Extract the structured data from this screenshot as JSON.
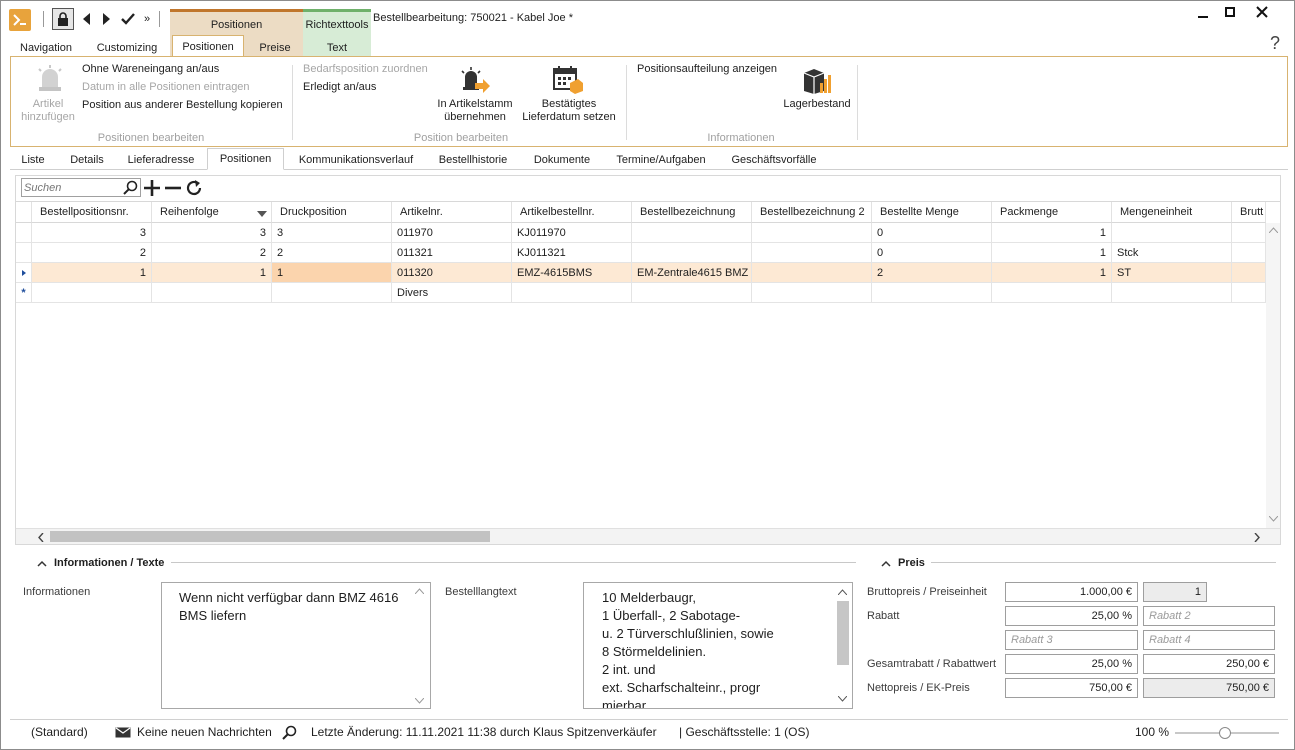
{
  "window": {
    "title": "Bestellbearbeitung: 750021 - Kabel Joe *"
  },
  "quick_access": [
    "lock-icon",
    "back-icon",
    "forward-icon",
    "check-icon",
    "more-icon"
  ],
  "context_tabs": {
    "group1": "Positionen",
    "group2": "Richtexttools"
  },
  "ribbon_tabs": [
    "Navigation",
    "Customizing",
    "Positionen",
    "Preise",
    "Text"
  ],
  "active_ribbon_tab": "Positionen",
  "help": "?",
  "ribbon": {
    "artikel_hinzufuegen": [
      "Artikel",
      "hinzufügen"
    ],
    "ohne_wareneingang": "Ohne Wareneingang an/aus",
    "datum_alle": "Datum in alle Positionen eintragen",
    "position_kopieren": "Position aus anderer Bestellung kopieren",
    "grp1": "Positionen bearbeiten",
    "bedarfsposition": "Bedarfsposition zuordnen",
    "erledigt": "Erledigt an/aus",
    "artikelstamm": [
      "In Artikelstamm",
      "übernehmen"
    ],
    "lieferdatum": [
      "Bestätigtes",
      "Lieferdatum setzen"
    ],
    "grp2": "Position bearbeiten",
    "positionsaufteilung": "Positionsaufteilung anzeigen",
    "lagerbestand": "Lagerbestand",
    "grp3": "Informationen"
  },
  "page_tabs": [
    "Liste",
    "Details",
    "Lieferadresse",
    "Positionen",
    "Kommunikationsverlauf",
    "Bestellhistorie",
    "Dokumente",
    "Termine/Aufgaben",
    "Geschäftsvorfälle"
  ],
  "search": {
    "placeholder": "Suchen"
  },
  "grid": {
    "columns": [
      "Bestellpositionsnr.",
      "Reihenfolge",
      "Druckposition",
      "Artikelnr.",
      "Artikelbestellnr.",
      "Bestellbezeichnung",
      "Bestellbezeichnung 2",
      "Bestellte Menge",
      "Packmenge",
      "Mengeneinheit",
      "Brutt"
    ],
    "rows": [
      [
        "3",
        "3",
        "3",
        "011970",
        "KJ011970",
        "",
        "",
        "0",
        "1",
        ""
      ],
      [
        "2",
        "2",
        "2",
        "011321",
        "KJ011321",
        "",
        "",
        "0",
        "1",
        "Stck"
      ],
      [
        "1",
        "1",
        "1",
        "011320",
        "EMZ-4615BMS",
        "EM-Zentrale4615 BMZ",
        "",
        "2",
        "1",
        "ST"
      ],
      [
        "",
        "",
        "",
        "Divers",
        "",
        "",
        "",
        "",
        "",
        ""
      ]
    ],
    "selected_row": 2,
    "new_row_marker": "*"
  },
  "info_section": {
    "title": "Informationen / Texte",
    "informationen_label": "Informationen",
    "informationen_text": "Wenn nicht verfügbar dann BMZ 4616 BMS liefern",
    "bestelllangtext_label": "Bestelllangtext",
    "bestelllangtext": [
      "10 Melderbaugr,",
      "1 Überfall-, 2 Sabotage-",
      "u. 2 Türverschlußlinien, sowie",
      "8 Störmeldelinien.",
      "2 int. und",
      "ext. Scharfschalteinr., progr",
      "mierbar"
    ]
  },
  "preis_section": {
    "title": "Preis",
    "bruttopreis_label": "Bruttopreis / Preiseinheit",
    "bruttopreis": "1.000,00 €",
    "preiseinheit": "1",
    "rabatt_label": "Rabatt",
    "rabatt": "25,00 %",
    "rabatt2": "Rabatt 2",
    "rabatt3": "Rabatt 3",
    "rabatt4": "Rabatt 4",
    "gesamtrabatt_label": "Gesamtrabatt / Rabattwert",
    "gesamtrabatt": "25,00 %",
    "rabattwert": "250,00 €",
    "nettopreis_label": "Nettopreis / EK-Preis",
    "nettopreis": "750,00 €",
    "ek_preis": "750,00 €"
  },
  "status": {
    "standard": "(Standard)",
    "nachrichten": "Keine neuen Nachrichten",
    "letzte_aenderung": "Letzte Änderung: 11.11.2021 11:38 durch Klaus Spitzenverkäufer",
    "geschaeftsstelle": "| Geschäftsstelle:  1 (OS)",
    "zoom": "100 %"
  },
  "colors": {
    "accent": "#e8a33c",
    "context_orange": "#ecdcc4",
    "context_green": "#d7ecd6",
    "selection": "#fde9d4"
  }
}
